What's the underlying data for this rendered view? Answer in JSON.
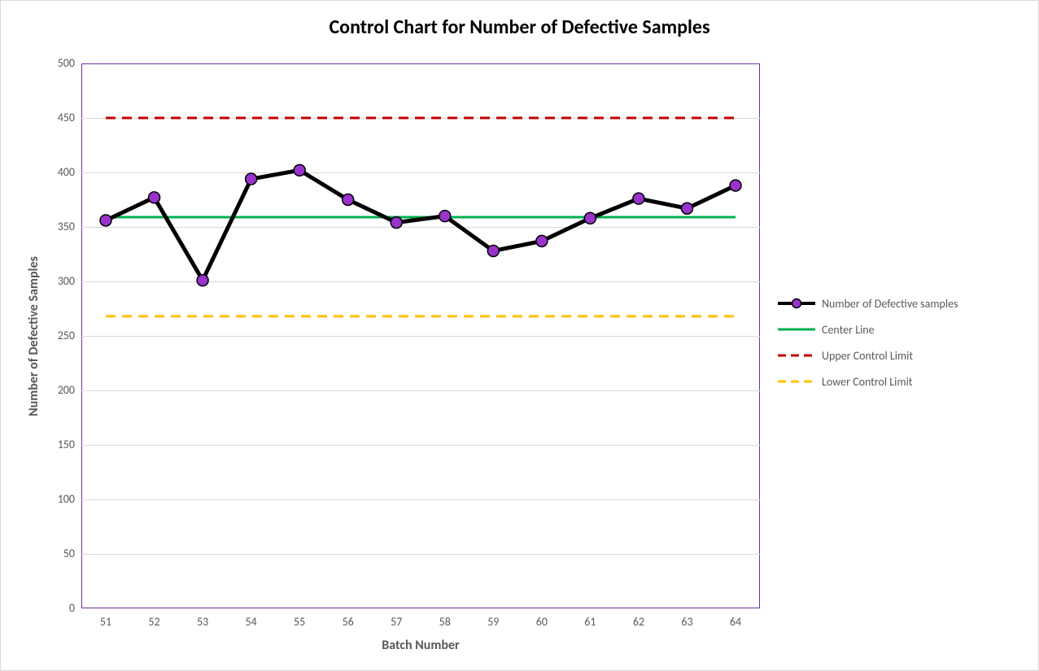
{
  "chart_data": {
    "type": "line",
    "title": "Control Chart for Number of Defective Samples",
    "xlabel": "Batch Number",
    "ylabel": "Number of Defective Samples",
    "x": [
      51,
      52,
      53,
      54,
      55,
      56,
      57,
      58,
      59,
      60,
      61,
      62,
      63,
      64
    ],
    "ylim": [
      0,
      500
    ],
    "y_ticks": [
      0,
      50,
      100,
      150,
      200,
      250,
      300,
      350,
      400,
      450,
      500
    ],
    "series": [
      {
        "name": "Number of Defective samples",
        "type": "line_marker",
        "color_line": "#000000",
        "color_marker_fill": "#9933CC",
        "color_marker_stroke": "#000000",
        "values": [
          356,
          377,
          301,
          394,
          402,
          375,
          354,
          360,
          328,
          337,
          358,
          376,
          367,
          388
        ]
      },
      {
        "name": "Center Line",
        "type": "solid_line",
        "color": "#00B050",
        "value": 359
      },
      {
        "name": "Upper Control Limit",
        "type": "dashed_line",
        "color": "#C00000",
        "value": 450
      },
      {
        "name": "Lower Control Limit",
        "type": "dashed_line",
        "color": "#FFC000",
        "value": 268
      }
    ],
    "legend_position": "right"
  },
  "title": "Control Chart for Number of Defective Samples",
  "axis": {
    "x": "Batch Number",
    "y": "Number of Defective Samples"
  },
  "legend": {
    "defectives": "Number of Defective samples",
    "center": "Center Line",
    "ucl": "Upper Control Limit",
    "lcl": "Lower Control Limit"
  },
  "x_tick_labels": [
    "51",
    "52",
    "53",
    "54",
    "55",
    "56",
    "57",
    "58",
    "59",
    "60",
    "61",
    "62",
    "63",
    "64"
  ],
  "y_tick_labels": [
    "0",
    "50",
    "100",
    "150",
    "200",
    "250",
    "300",
    "350",
    "400",
    "450",
    "500"
  ]
}
